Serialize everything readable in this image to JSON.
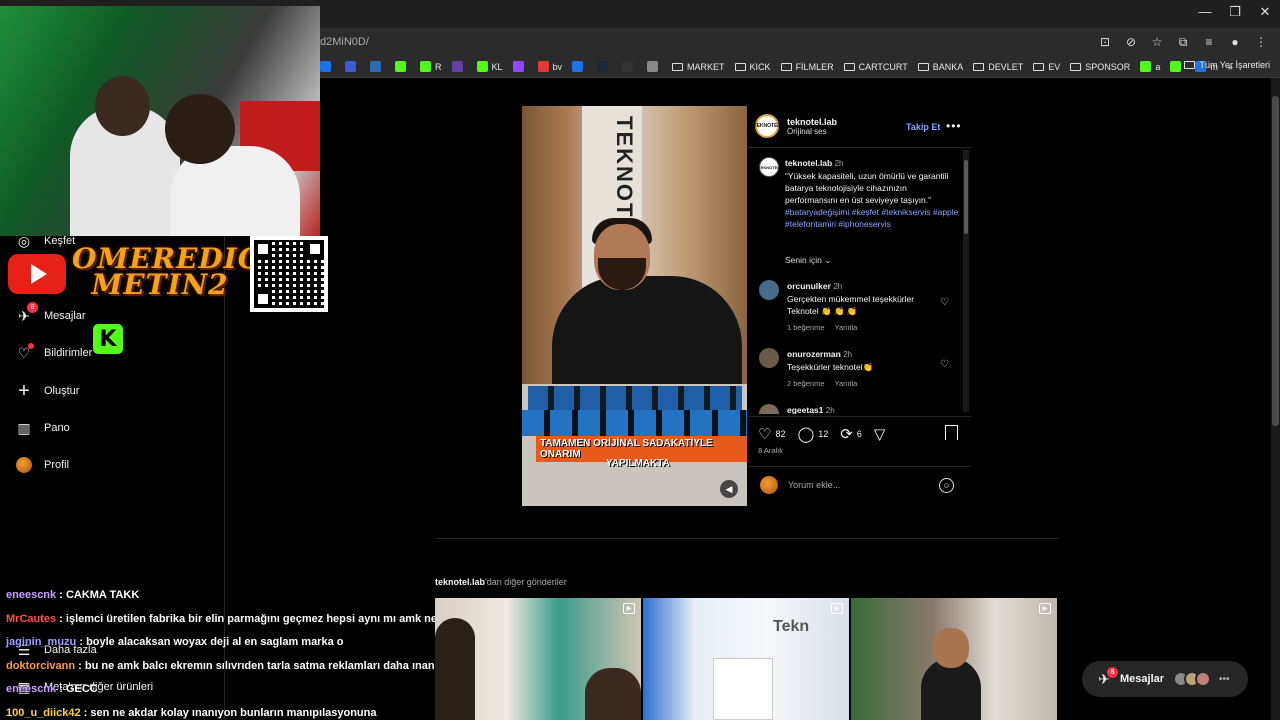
{
  "browser": {
    "url_fragment": "d2MiN0D/",
    "window_controls": [
      "—",
      "❐",
      "✕"
    ],
    "bookmarks": [
      {
        "label": "",
        "color": "#1a73e8"
      },
      {
        "label": "",
        "color": "#3b5bdb"
      },
      {
        "label": "",
        "color": "#2b6cb0"
      },
      {
        "label": "",
        "color": "#53fc18"
      },
      {
        "label": "R",
        "color": "#53fc18"
      },
      {
        "label": "",
        "color": "#6441a5"
      },
      {
        "label": "KL",
        "color": "#53fc18"
      },
      {
        "label": "",
        "color": "#9146ff"
      },
      {
        "label": "bv",
        "color": "#e53935"
      },
      {
        "label": "",
        "color": "#1a73e8"
      },
      {
        "label": "",
        "color": "#1b2838"
      },
      {
        "label": "",
        "color": "#333"
      },
      {
        "label": "",
        "color": "#888"
      }
    ],
    "folders": [
      "MARKET",
      "KICK",
      "FİLMLER",
      "CARTCURT",
      "BANKA",
      "DEVLET",
      "EV",
      "SPONSOR"
    ],
    "extras": [
      {
        "label": "a",
        "color": "#53fc18"
      },
      {
        "label": "",
        "color": "#53fc18"
      },
      {
        "label": "m",
        "color": "#1a73e8"
      }
    ],
    "all_bookmarks": "Tüm Yer İşaretleri"
  },
  "overlay": {
    "brand_line1": "OMEREDIC",
    "brand_line2": "METIN2",
    "kick_letter": "K"
  },
  "sidebar": {
    "items": [
      {
        "label": "Keşfet",
        "icon": "compass-icon",
        "glyph": "◎",
        "badge": ""
      },
      {
        "label": "Mesajlar",
        "icon": "messenger-icon",
        "glyph": "✈",
        "badge": "8"
      },
      {
        "label": "Bildirimler",
        "icon": "heart-icon",
        "glyph": "♡",
        "badge": ""
      },
      {
        "label": "Oluştur",
        "icon": "plus-icon",
        "glyph": "+",
        "badge": ""
      },
      {
        "label": "Pano",
        "icon": "dashboard-icon",
        "glyph": "▥",
        "badge": ""
      },
      {
        "label": "Profil",
        "icon": "profile-avatar",
        "glyph": "",
        "badge": ""
      }
    ],
    "more": "Daha fazla",
    "meta": "Meta'nın diğer ürünleri"
  },
  "chat": [
    {
      "user": "eneescnk",
      "color": "#c8a0ff",
      "text": "CAKMA TAKK"
    },
    {
      "user": "MrCautes",
      "color": "#ff4d4d",
      "text": "işlemci üretilen fabrika bir elin parmağını geçmez hepsi aynı mı amk ne alaka"
    },
    {
      "user": "jaginin_muzu",
      "color": "#a0a0ff",
      "text": "boyle alacaksan woyax deji al en saglam marka o"
    },
    {
      "user": "doktorcivann",
      "color": "#ff9a3c",
      "text": "bu ne amk balcı ekremın sılıvrıden tarla satma reklamları daha ınandırıcı"
    },
    {
      "user": "eneescnk",
      "color": "#c8a0ff",
      "text": "GECC"
    },
    {
      "user": "100_u_diick42",
      "color": "#ffd23c",
      "text": "sen ne akdar kolay ınanıyon bunların manıpılasyonuna"
    }
  ],
  "post": {
    "username": "teknotel.lab",
    "audio": "Orijinal ses",
    "follow": "Takip Et",
    "logo_text": "TEKNOTEL",
    "video_caption_1": "TAMAMEN ORİJİNAL SADAKATİYLE ONARIM",
    "video_caption_2": "YAPILMAKTA",
    "sign": "TEKNOT",
    "caption_user": "teknotel.lab",
    "caption_time": "2h",
    "caption": "“Yüksek kapasiteli, uzun ömürlü ve garantili batarya teknolojisiyle cihazınızın performansını en üst seviyeye taşıyın.”",
    "hashtags": "#bataryadeğişimi #keşfet #teknikservis #apple #telefontamiri #iphoneservis",
    "senin_icin": "Senin için",
    "comments": [
      {
        "user": "orcunulker",
        "time": "2h",
        "text": "Gerçekten mükemmel teşekkürler Teknotel 👏 👏 👏",
        "likes": "1 beğenme",
        "reply": "Yanıtla",
        "avatar": "#4a6a8a"
      },
      {
        "user": "onurozerman",
        "time": "2h",
        "text": "Teşekkürler teknotel👏",
        "likes": "2 beğenme",
        "reply": "Yanıtla",
        "avatar": "#6a5a4a"
      },
      {
        "user": "egeetas1",
        "time": "2h",
        "text": "",
        "likes": "",
        "reply": "",
        "avatar": "#7a6a5a"
      }
    ],
    "like_count": "82",
    "comment_count": "12",
    "repost_count": "6",
    "date": "8 Aralık",
    "comment_placeholder": "Yorum ekle..."
  },
  "more_posts": {
    "user": "teknotel.lab",
    "suffix": "'dan diğer gönderiler"
  },
  "messages_float": {
    "label": "Mesajlar",
    "badge": "8"
  }
}
